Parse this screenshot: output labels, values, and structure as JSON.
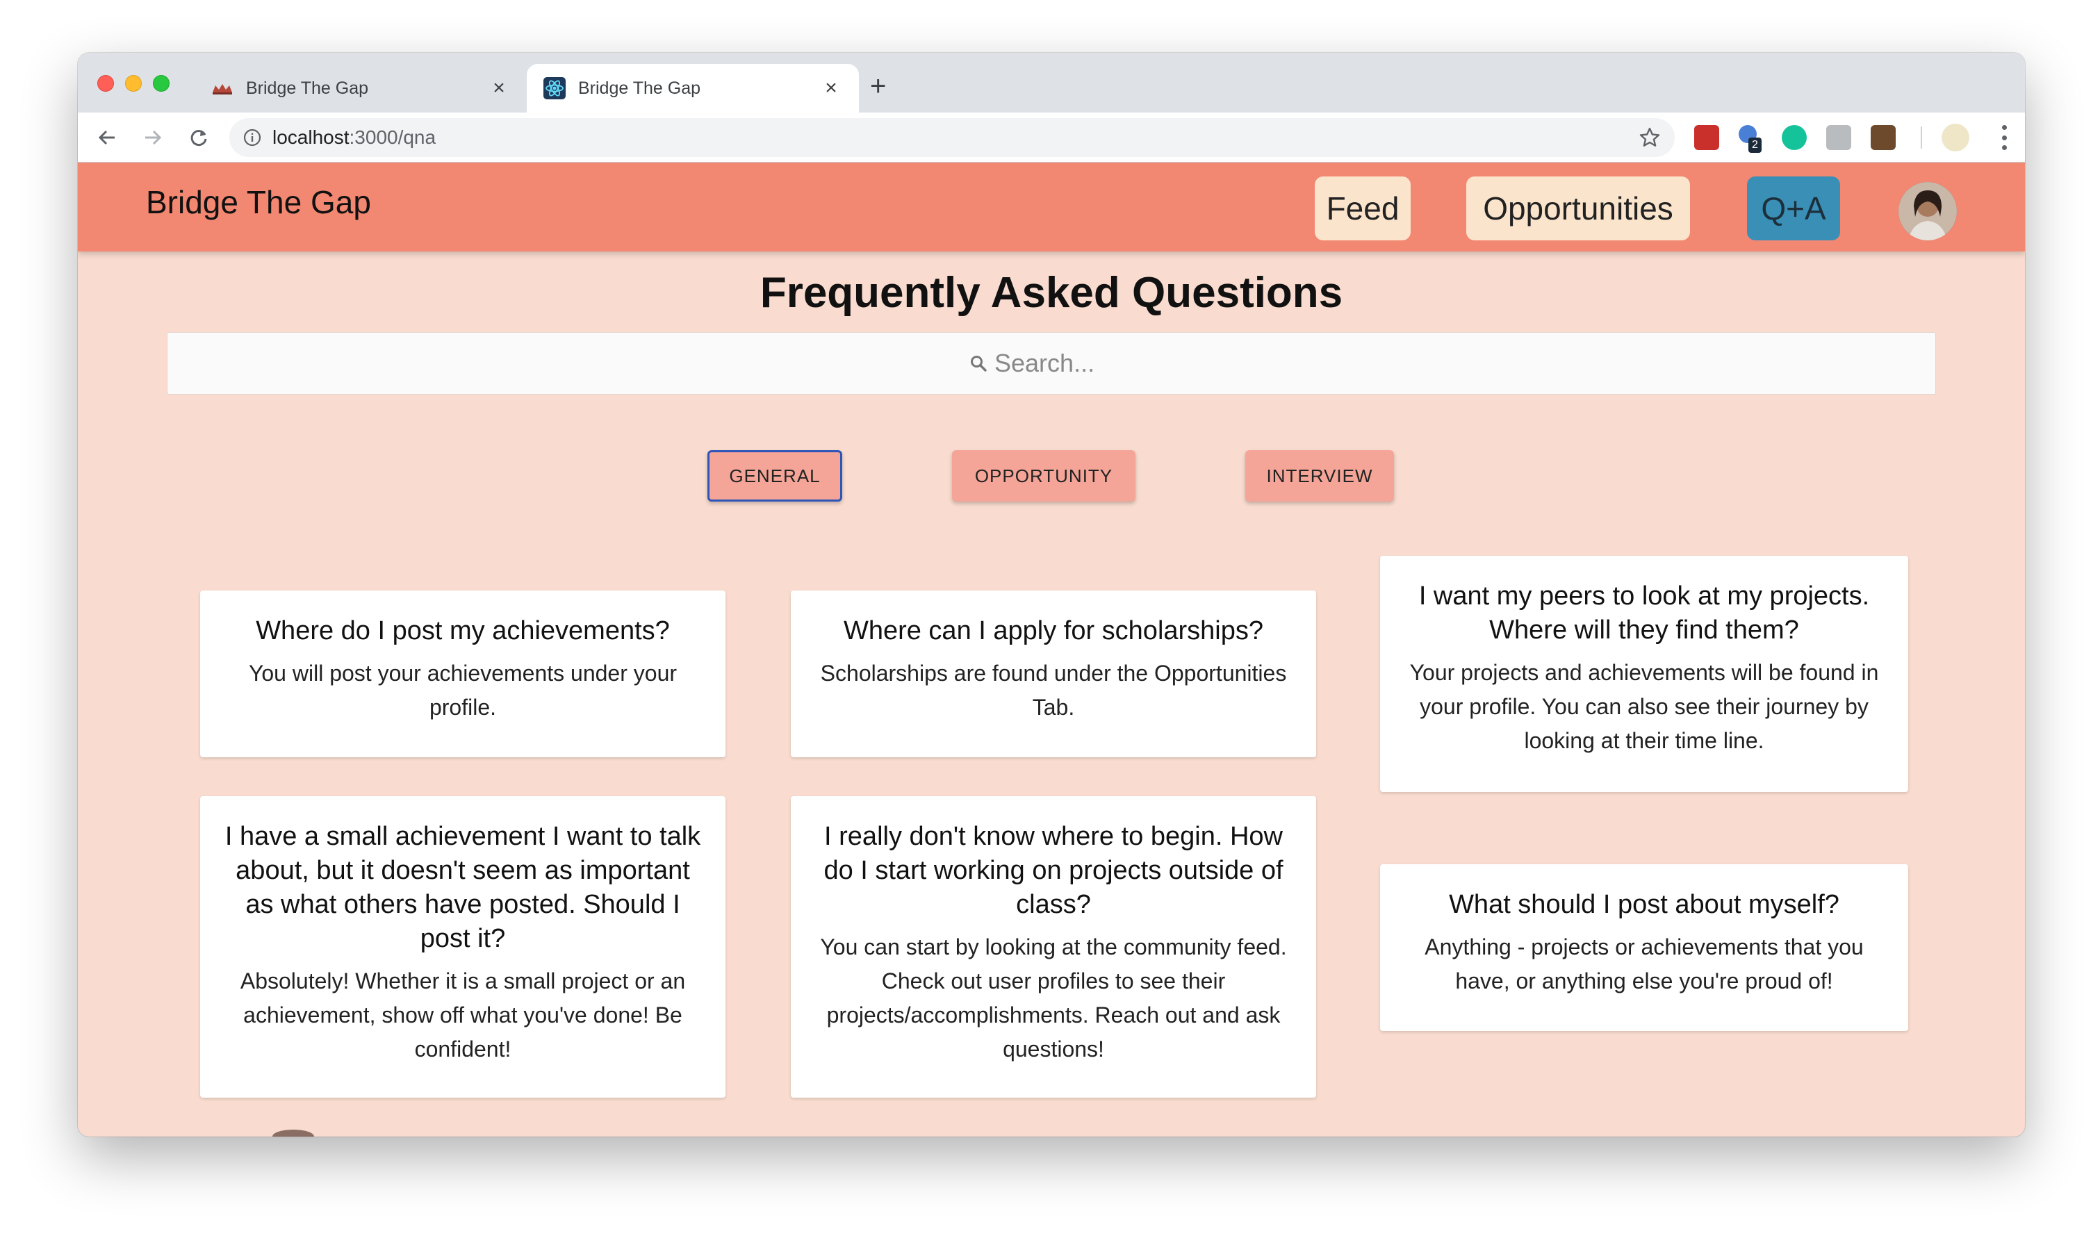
{
  "browser": {
    "tabs": [
      {
        "title": "Bridge The Gap",
        "active": false,
        "favicon": "crown-icon"
      },
      {
        "title": "Bridge The Gap",
        "active": true,
        "favicon": "react-atom-icon"
      }
    ],
    "url_host": "localhost",
    "url_path": ":3000/qna",
    "extension_badge": "2"
  },
  "header": {
    "brand": "Bridge The Gap",
    "nav": {
      "feed": "Feed",
      "opportunities": "Opportunities",
      "qna": "Q+A"
    },
    "active_nav": "qna"
  },
  "main": {
    "title": "Frequently Asked Questions",
    "search_placeholder": "Search...",
    "categories": {
      "general": "GENERAL",
      "opportunity": "OPPORTUNITY",
      "interview": "INTERVIEW"
    },
    "selected_category": "general",
    "faqs": [
      {
        "question": "Where do I post my achievements?",
        "answer": "You will post your achievements under your profile."
      },
      {
        "question": "Where can I apply for scholarships?",
        "answer": "Scholarships are found under the Opportunities Tab."
      },
      {
        "question": "I want my peers to look at my projects. Where will they find them?",
        "answer": "Your projects and achievements will be found in your profile. You can also see their journey by looking at their time line."
      },
      {
        "question": "I have a small achievement I want to talk about, but it doesn't seem as important as what others have posted. Should I post it?",
        "answer": "Absolutely! Whether it is a small project or an achievement, show off what you've done! Be confident!"
      },
      {
        "question": "I really don't know where to begin. How do I start working on projects outside of class?",
        "answer": "You can start by looking at the community feed. Check out user profiles to see their projects/accomplishments. Reach out and ask questions!"
      },
      {
        "question": "What should I post about myself?",
        "answer": "Anything - projects or achievements that you have, or anything else you're proud of!"
      }
    ]
  },
  "colors": {
    "header_bg": "#f28772",
    "page_bg": "#f9dccf",
    "nav_pill_bg": "#fbe4cc",
    "nav_active_bg": "#3a8fb7",
    "category_bg": "#f4a598",
    "category_selected_border": "#2d55b8"
  }
}
